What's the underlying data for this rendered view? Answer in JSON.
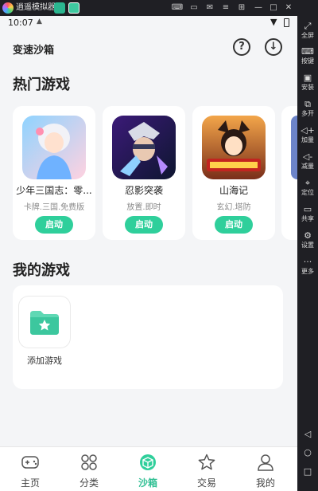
{
  "window": {
    "title": "逍遥模拟器",
    "titlebar_icons": [
      "keyboard-icon",
      "screen-icon",
      "mail-icon",
      "menu-icon",
      "bag-icon",
      "minimize-icon",
      "maximize-icon",
      "close-icon"
    ]
  },
  "emulator_sidebar": {
    "collapse_label": "<<<",
    "items": [
      {
        "label": "全屏",
        "icon": "fullscreen-icon"
      },
      {
        "label": "按键",
        "icon": "keyboard-icon"
      },
      {
        "label": "安装",
        "icon": "apk-icon"
      },
      {
        "label": "多开",
        "icon": "multi-instance-icon"
      },
      {
        "label": "加量",
        "icon": "volume-up-icon"
      },
      {
        "label": "减量",
        "icon": "volume-down-icon"
      },
      {
        "label": "定位",
        "icon": "location-icon"
      },
      {
        "label": "共享",
        "icon": "folder-icon"
      },
      {
        "label": "设置",
        "icon": "gear-icon"
      },
      {
        "label": "更多",
        "icon": "more-icon"
      }
    ],
    "nav_icons": [
      "back-icon",
      "home-icon",
      "recent-apps-icon"
    ]
  },
  "status_bar": {
    "time": "10:07"
  },
  "header": {
    "title": "变速沙箱",
    "help_icon": "question-icon",
    "download_icon": "download-icon"
  },
  "hot_games": {
    "title": "热门游戏",
    "games": [
      {
        "name": "少年三国志：零...",
        "tags": "卡牌.三国.免费版",
        "button": "启动"
      },
      {
        "name": "忍影突袭",
        "tags": "放置.即时",
        "button": "启动"
      },
      {
        "name": "山海记",
        "tags": "玄幻.塔防",
        "button": "启动"
      }
    ]
  },
  "my_games": {
    "title": "我的游戏",
    "add_label": "添加游戏"
  },
  "tabbar": {
    "active": "沙箱",
    "items": [
      {
        "label": "主页",
        "icon": "gamepad-icon"
      },
      {
        "label": "分类",
        "icon": "grid-icon"
      },
      {
        "label": "沙箱",
        "icon": "box-icon"
      },
      {
        "label": "交易",
        "icon": "star-icon"
      },
      {
        "label": "我的",
        "icon": "user-icon"
      }
    ]
  },
  "colors": {
    "accent": "#2fcf9b",
    "background": "#f4f5f7",
    "emulator_chrome": "#1f1f24"
  }
}
